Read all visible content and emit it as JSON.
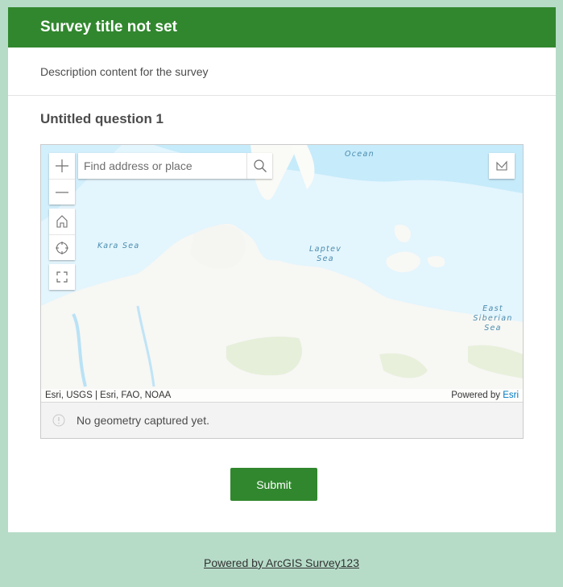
{
  "header": {
    "title": "Survey title not set"
  },
  "description": "Description content for the survey",
  "question": {
    "label": "Untitled question 1",
    "map": {
      "search": {
        "placeholder": "Find address or place",
        "value": ""
      },
      "controls": [
        {
          "name": "zoom-in",
          "icon": "plus-icon"
        },
        {
          "name": "zoom-out",
          "icon": "minus-icon"
        },
        {
          "name": "home",
          "icon": "home-icon"
        },
        {
          "name": "locate",
          "icon": "crosshair-icon"
        },
        {
          "name": "fullscreen",
          "icon": "expand-icon"
        }
      ],
      "basemap_toggle_icon": "basemap-icon",
      "labels": {
        "arctic_ocean": "Ocean",
        "kara_sea": "Kara Sea",
        "laptev_sea_1": "Laptev",
        "laptev_sea_2": "Sea",
        "east_siberian_1": "East Siberian",
        "east_siberian_2": "Sea"
      },
      "attribution": {
        "sources": "Esri, USGS | Esri, FAO, NOAA",
        "powered_prefix": "Powered by ",
        "powered_link": "Esri"
      }
    },
    "status": {
      "icon": "info-icon",
      "text": "No geometry captured yet."
    }
  },
  "submit_label": "Submit",
  "footer": {
    "link": "Powered by ArcGIS Survey123"
  },
  "colors": {
    "brand_green": "#31872e",
    "page_background": "#b6dcc8",
    "link_blue": "#0079c1"
  }
}
